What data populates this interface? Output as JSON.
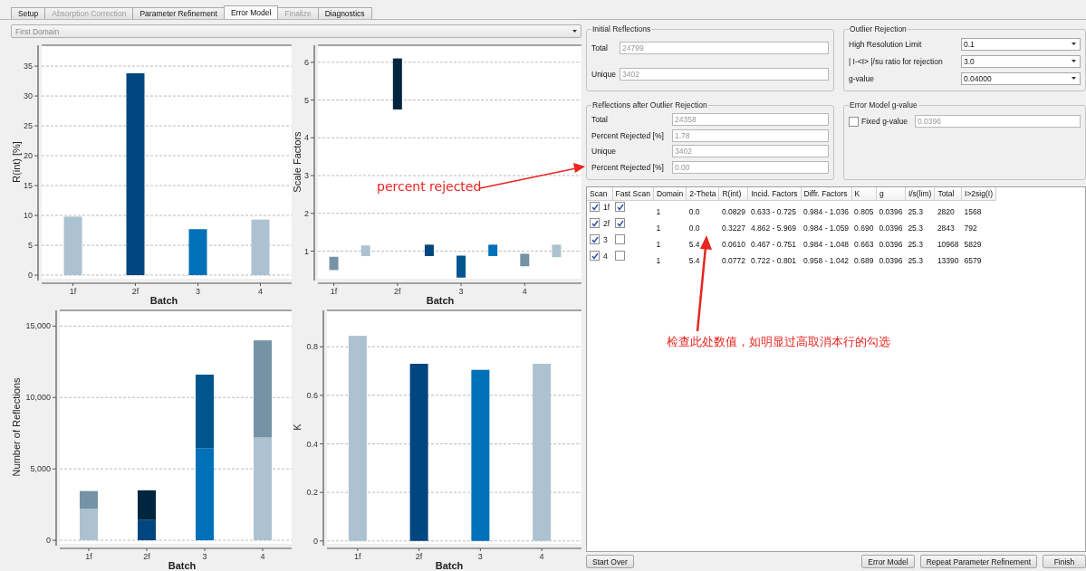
{
  "tabs": [
    {
      "label": "Setup",
      "selected": false,
      "disabled": false
    },
    {
      "label": "Absorption Correction",
      "selected": false,
      "disabled": true
    },
    {
      "label": "Parameter Refinement",
      "selected": false,
      "disabled": false
    },
    {
      "label": "Error Model",
      "selected": true,
      "disabled": false
    },
    {
      "label": "Finalize",
      "selected": false,
      "disabled": true
    },
    {
      "label": "Diagnostics",
      "selected": false,
      "disabled": false
    }
  ],
  "domain_select": {
    "value": "First Domain"
  },
  "charts": [
    {
      "chart_data": {
        "type": "bar",
        "grid": true,
        "xlabel": "Batch",
        "ylabel": "R(int) [%]",
        "categories": [
          "1f",
          "2f",
          "3",
          "4"
        ],
        "series": [
          {
            "values": [
              9.8,
              33.8,
              7.7,
              9.3
            ],
            "colors": [
              "#adc2d0",
              "#00467f",
              "#0070b8",
              "#adc2d0"
            ]
          }
        ],
        "ylim": [
          -0.6,
          38.5
        ],
        "yticks": [
          0,
          5,
          10,
          15,
          20,
          25,
          30,
          35
        ]
      }
    },
    {
      "chart_data": {
        "type": "candlestick",
        "grid": true,
        "xlabel": "Batch",
        "ylabel": "Scale Factors",
        "categories": [
          "1f",
          null,
          "2f",
          null,
          "3",
          null,
          "4",
          null
        ],
        "series": [
          {
            "ohlc": [
              [
                0.5,
                0.85,
                0.5,
                0.85
              ],
              [
                0.87,
                1.15,
                0.87,
                1.15
              ],
              [
                4.75,
                6.1,
                4.75,
                6.1
              ],
              [
                0.87,
                1.17,
                0.87,
                1.17
              ],
              [
                0.3,
                0.88,
                0.3,
                0.88
              ],
              [
                0.87,
                1.17,
                0.87,
                1.17
              ],
              [
                0.6,
                0.93,
                0.6,
                0.93
              ],
              [
                0.84,
                1.17,
                0.84,
                1.17
              ]
            ],
            "colors": [
              "#7593a5",
              "#adc2d0",
              "#00253f",
              "#00467f",
              "#00558f",
              "#0070b8",
              "#7593a5",
              "#adc2d0"
            ]
          }
        ],
        "ylim": [
          0.27,
          6.45
        ],
        "yticks": [
          1,
          2,
          3,
          4,
          5,
          6
        ]
      }
    },
    {
      "chart_data": {
        "type": "bar",
        "grid": true,
        "stacked": true,
        "xlabel": "Batch",
        "ylabel": "Number of Reflections",
        "categories": [
          "1f",
          "2f",
          "3",
          "4"
        ],
        "series": [
          {
            "values": [
              2200,
              1450,
              6450,
              7200
            ],
            "colors": [
              "#adc2d0",
              "#00467f",
              "#0070b8",
              "#adc2d0"
            ]
          },
          {
            "values": [
              1250,
              2050,
              5150,
              6800
            ],
            "colors": [
              "#7593a5",
              "#00253f",
              "#00558f",
              "#7593a5"
            ]
          }
        ],
        "ylim": [
          -250,
          16100
        ],
        "yticks": [
          {
            "value": 0,
            "label": "0"
          },
          {
            "value": 5000,
            "label": "5,000"
          },
          {
            "value": 10000,
            "label": "10,000"
          },
          {
            "value": 15000,
            "label": "15,000"
          }
        ]
      }
    },
    {
      "chart_data": {
        "type": "bar",
        "grid": true,
        "xlabel": "Batch",
        "ylabel": "K",
        "categories": [
          "1f",
          "2f",
          "3",
          "4"
        ],
        "series": [
          {
            "values": [
              0.845,
              0.73,
              0.705,
              0.73
            ],
            "colors": [
              "#adc2d0",
              "#00467f",
              "#0070b8",
              "#adc2d0"
            ]
          }
        ],
        "ylim": [
          -0.012,
          0.95
        ],
        "yticks": [
          0,
          0.2,
          0.4,
          0.6,
          0.8
        ]
      }
    }
  ],
  "initial_reflections": {
    "title": "Initial Reflections",
    "fields": [
      {
        "label": "Total",
        "value": "24799"
      },
      {
        "label": "Unique",
        "value": "3402"
      }
    ]
  },
  "outlier_rejection": {
    "title": "Outlier Rejection",
    "fields": [
      {
        "label": "High Resolution Limit",
        "value": "0.1"
      },
      {
        "label": "| I-<I> |/su ratio for rejection",
        "value": "3.0"
      },
      {
        "label": "g-value",
        "value": "0.04000"
      }
    ]
  },
  "after_rejection": {
    "title": "Reflections after Outlier Rejection",
    "fields": [
      {
        "label": "Total",
        "value": "24358"
      },
      {
        "label": "Percent Rejected [%]",
        "value": "1.78"
      },
      {
        "label": "Unique",
        "value": "3402"
      },
      {
        "label": "Percent Rejected [%]",
        "value": "0.00"
      }
    ]
  },
  "error_model_g": {
    "title": "Error Model g-value",
    "label": "Fixed g-value",
    "checked": false,
    "value": "0.0396"
  },
  "scan_table": {
    "columns": [
      "Scan",
      "Fast Scan",
      "Domain",
      "2-Theta",
      "R(int)",
      "Incid. Factors",
      "Diffr. Factors",
      "K",
      "g",
      "I/s(lim)",
      "Total",
      "I>2sig(I)"
    ],
    "rows": [
      {
        "scan_checked": true,
        "fast_scan_checked": true,
        "cells": [
          "1f",
          "",
          "1",
          "0.0",
          "0.0829",
          "0.633 - 0.725",
          "0.984 - 1.036",
          "0.805",
          "0.0396",
          "25.3",
          "2820",
          "1568"
        ]
      },
      {
        "scan_checked": true,
        "fast_scan_checked": true,
        "cells": [
          "2f",
          "",
          "1",
          "0.0",
          "0.3227",
          "4.862 - 5.969",
          "0.984 - 1.059",
          "0.690",
          "0.0396",
          "25.3",
          "2843",
          "792"
        ]
      },
      {
        "scan_checked": true,
        "fast_scan_checked": false,
        "cells": [
          "3",
          "",
          "1",
          "5.4",
          "0.0610",
          "0.467 - 0.751",
          "0.984 - 1.048",
          "0.663",
          "0.0396",
          "25.3",
          "10968",
          "5829"
        ]
      },
      {
        "scan_checked": true,
        "fast_scan_checked": false,
        "cells": [
          "4",
          "",
          "1",
          "5.4",
          "0.0772",
          "0.722 - 0.801",
          "0.958 - 1.042",
          "0.689",
          "0.0396",
          "25.3",
          "13390",
          "6579"
        ]
      }
    ]
  },
  "buttons_left": [
    "Start Over"
  ],
  "buttons_right": [
    "Error Model",
    "Repeat Parameter Refinement",
    "Finish"
  ],
  "annotations": [
    {
      "text": "percent rejected"
    },
    {
      "text": "检查此处数值，如明显过高取消本行的勾选"
    }
  ]
}
